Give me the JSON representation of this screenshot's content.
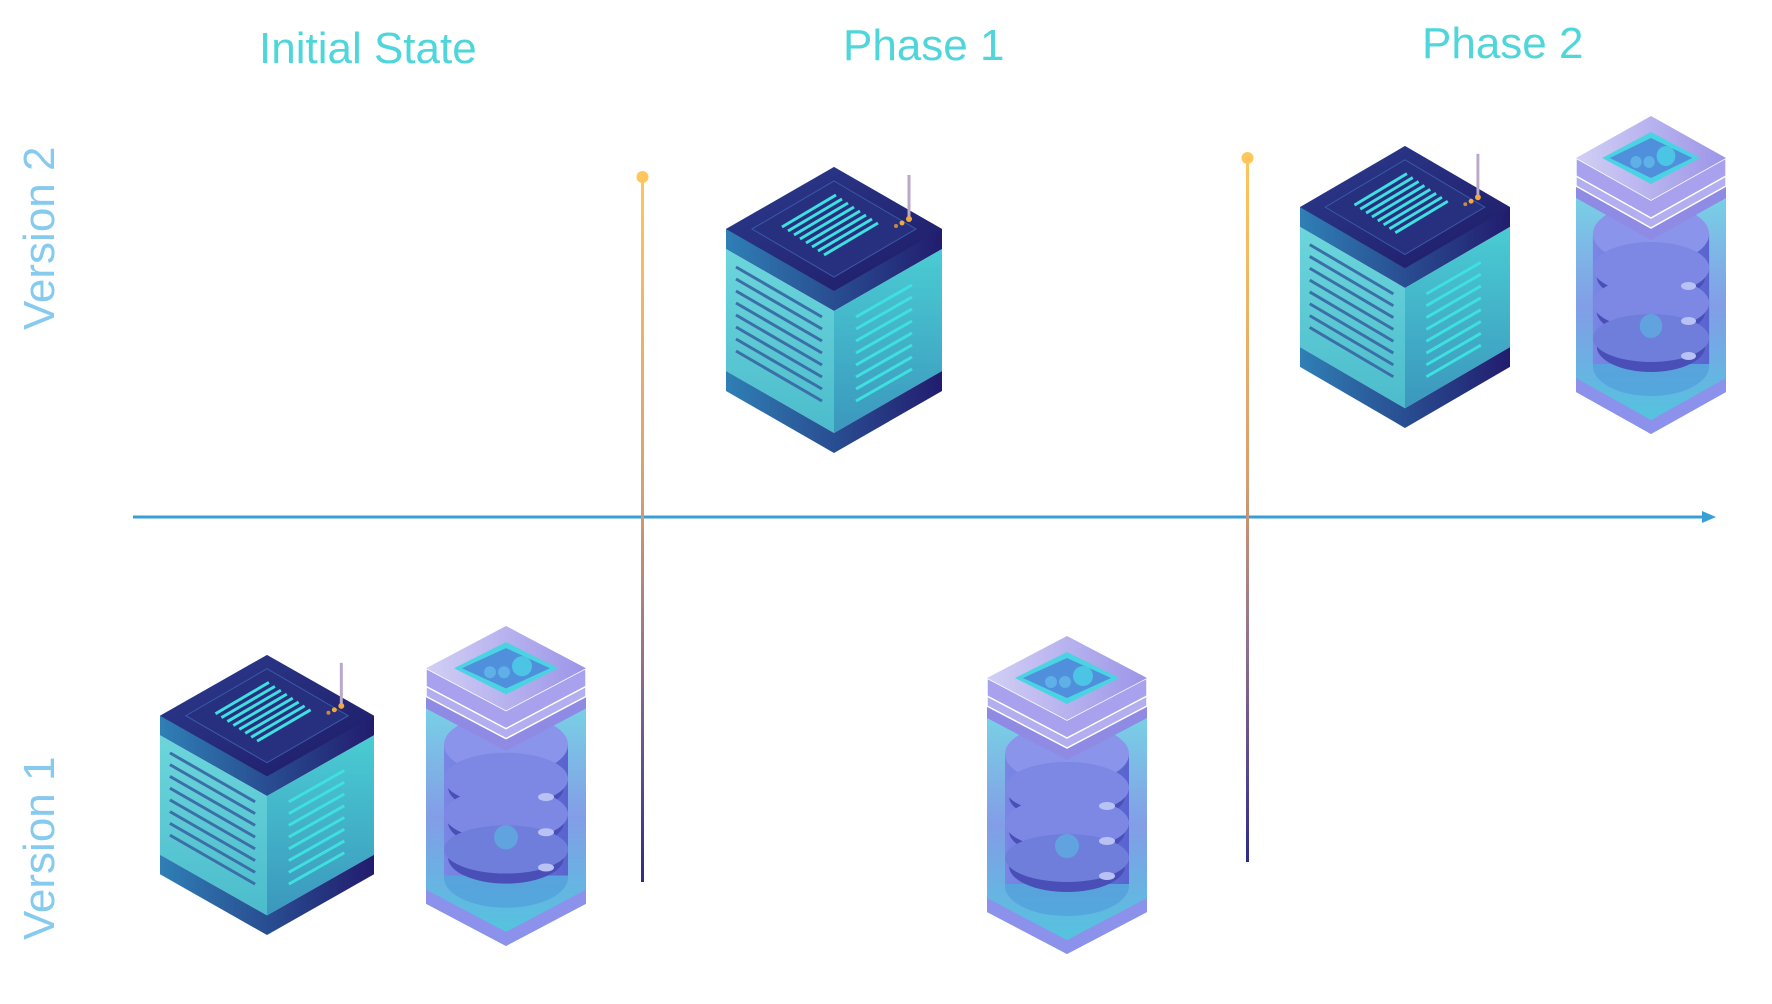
{
  "columns": [
    {
      "title": "Initial State"
    },
    {
      "title": "Phase 1"
    },
    {
      "title": "Phase 2"
    }
  ],
  "rows": [
    {
      "label": "Version 2"
    },
    {
      "label": "Version 1"
    }
  ],
  "colors": {
    "title": "#4FD6DB",
    "row_label": "#86CBEF",
    "timeline_axis": "#389FD6",
    "divider_top": "#FFC65C",
    "divider_bottom": "#2E2A8A"
  },
  "cells": {
    "initial_state": {
      "version_2": [],
      "version_1": [
        "server-icon",
        "database-icon"
      ]
    },
    "phase_1": {
      "version_2": [
        "server-icon"
      ],
      "version_1": [
        "database-icon"
      ]
    },
    "phase_2": {
      "version_2": [
        "server-icon",
        "database-icon"
      ],
      "version_1": []
    }
  }
}
